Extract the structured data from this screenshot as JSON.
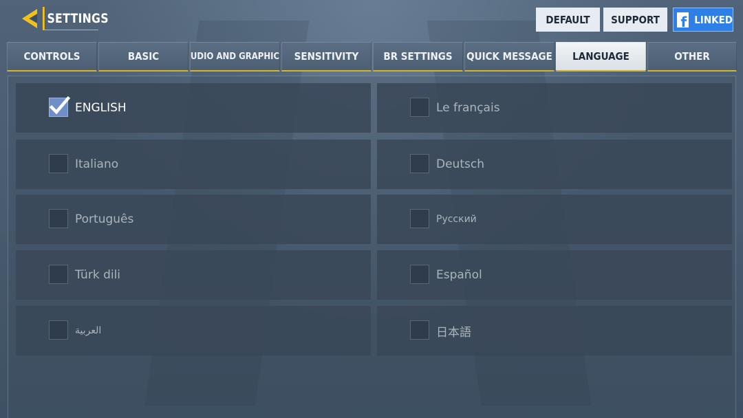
{
  "header": {
    "title": "SETTINGS",
    "back_icon": "back-arrow-icon",
    "accent_color": "#f2c21b"
  },
  "top_buttons": {
    "default_label": "DEFAULT",
    "support_label": "SUPPORT",
    "linked_label": "LINKED",
    "linked_icon": "facebook-icon",
    "facebook_color": "#2f80e6"
  },
  "tabs": [
    {
      "label": "CONTROLS",
      "active": false
    },
    {
      "label": "BASIC",
      "active": false
    },
    {
      "label": "AUDIO AND GRAPHICS",
      "active": false
    },
    {
      "label": "SENSITIVITY",
      "active": false
    },
    {
      "label": "BR SETTINGS",
      "active": false
    },
    {
      "label": "QUICK MESSAGE",
      "active": false
    },
    {
      "label": "LANGUAGE",
      "active": true
    },
    {
      "label": "OTHER",
      "active": false
    }
  ],
  "languages": [
    {
      "label": "ENGLISH",
      "checked": true
    },
    {
      "label": "Le français",
      "checked": false
    },
    {
      "label": "Italiano",
      "checked": false
    },
    {
      "label": "Deutsch",
      "checked": false
    },
    {
      "label": "Português",
      "checked": false
    },
    {
      "label": "Русский",
      "checked": false
    },
    {
      "label": "Türk dili",
      "checked": false
    },
    {
      "label": "Español",
      "checked": false
    },
    {
      "label": "العربية",
      "checked": false
    },
    {
      "label": "日本語",
      "checked": false
    }
  ]
}
